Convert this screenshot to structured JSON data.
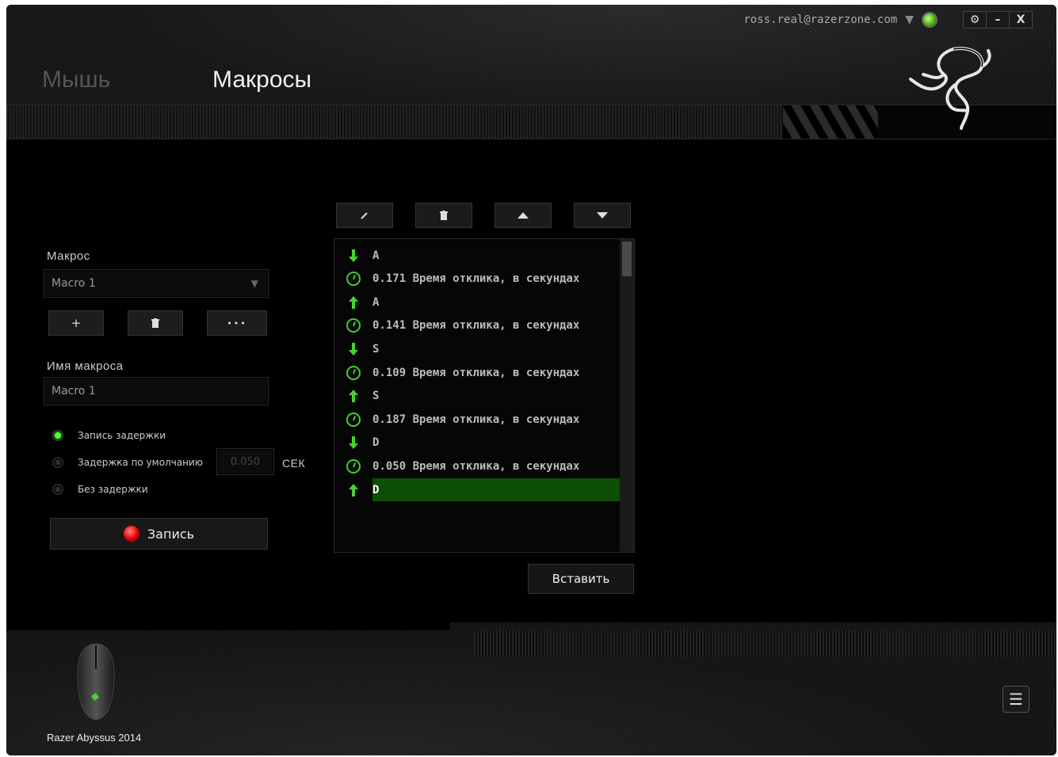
{
  "header": {
    "tabs": [
      {
        "label": "Мышь",
        "active": false
      },
      {
        "label": "Макросы",
        "active": true
      }
    ],
    "account_email": "ross.real@razerzone.com",
    "window_buttons": {
      "settings_icon": "gear-icon",
      "minimize_label": "–",
      "close_label": "X"
    }
  },
  "left_panel": {
    "macro_label": "Макрос",
    "macro_select_value": "Macro 1",
    "add_label": "+",
    "more_label": "•••",
    "name_label": "Имя макроса",
    "name_value": "Macro 1",
    "delay_options": [
      {
        "label": "Запись задержки",
        "selected": true
      },
      {
        "label": "Задержка по умолчанию",
        "selected": false
      },
      {
        "label": "Без задержки",
        "selected": false
      }
    ],
    "default_delay_value": "0.050",
    "delay_unit": "СЕК",
    "record_label": "Запись"
  },
  "list": {
    "items": [
      {
        "type": "key-down",
        "text": "A"
      },
      {
        "type": "delay",
        "text": "0.171 Время отклика, в секундах"
      },
      {
        "type": "key-up",
        "text": "A"
      },
      {
        "type": "delay",
        "text": "0.141 Время отклика, в секундах"
      },
      {
        "type": "key-down",
        "text": "S"
      },
      {
        "type": "delay",
        "text": "0.109 Время отклика, в секундах"
      },
      {
        "type": "key-up",
        "text": "S"
      },
      {
        "type": "delay",
        "text": "0.187 Время отклика, в секундах"
      },
      {
        "type": "key-down",
        "text": "D"
      },
      {
        "type": "delay",
        "text": "0.050 Время отклика, в секундах"
      },
      {
        "type": "key-up",
        "text": "D",
        "selected": true
      }
    ],
    "insert_label": "Вставить"
  },
  "footer": {
    "device_name": "Razer Abyssus 2014"
  },
  "colors": {
    "accent": "#44d62c",
    "selection": "#0b4e05",
    "record": "#e00000"
  }
}
